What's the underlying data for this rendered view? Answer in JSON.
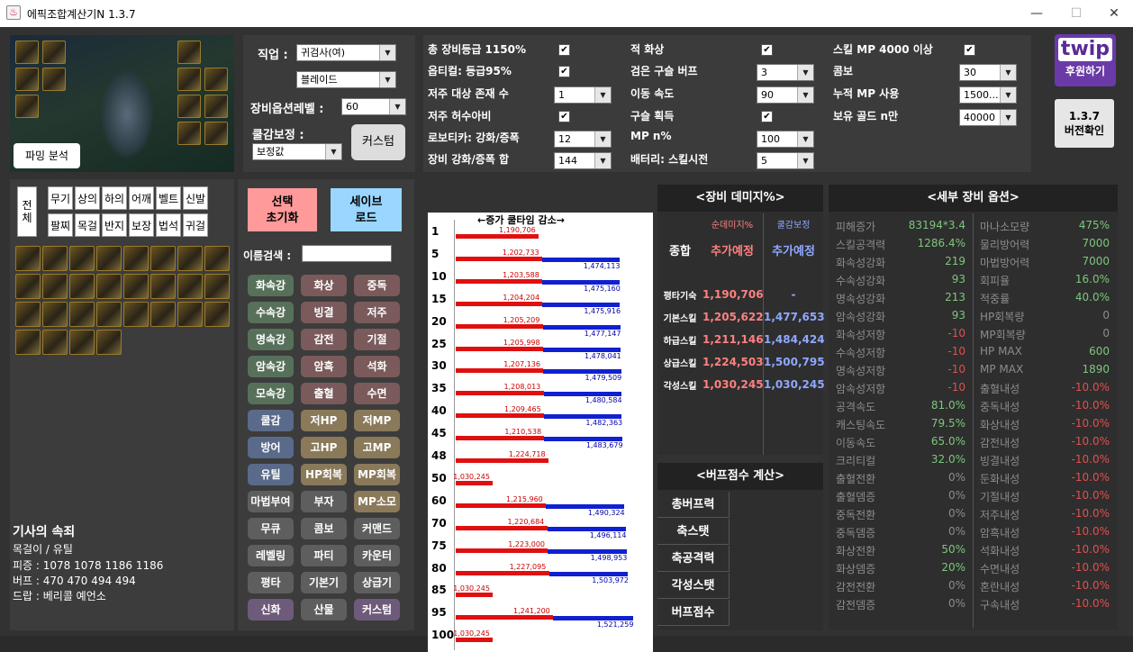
{
  "window": {
    "title": "에픽조합계산기N 1.3.7",
    "minimize": "—",
    "maximize": "☐",
    "close": "✕"
  },
  "left": {
    "parsing_button": "파밍 분석"
  },
  "job": {
    "label": "직업 :",
    "value1": "귀검사(여)",
    "value2": "블레이드",
    "equip_level_label": "장비옵션레벨 :",
    "equip_level": "60",
    "coolreduce_label": "쿨감보정 :",
    "coolreduce_value": "보정값",
    "custom_button": "커스텀"
  },
  "options": [
    {
      "label": "총 장비등급 1150%",
      "type": "check",
      "checked": true
    },
    {
      "label": "옵티컬: 등급95%",
      "type": "check",
      "checked": true
    },
    {
      "label": "저주 대상 존재 수",
      "type": "select",
      "value": "1"
    },
    {
      "label": "저주 허수아비",
      "type": "check",
      "checked": true
    },
    {
      "label": "로보티카: 강화/증폭",
      "type": "select",
      "value": "12"
    },
    {
      "label": "장비 강화/증폭 합",
      "type": "select",
      "value": "144"
    },
    {
      "label": "적 화상",
      "type": "check",
      "checked": true
    },
    {
      "label": "검은 구슬 버프",
      "type": "select",
      "value": "3"
    },
    {
      "label": "이동 속도",
      "type": "select",
      "value": "90"
    },
    {
      "label": "구슬 획득",
      "type": "check",
      "checked": true
    },
    {
      "label": "MP n%",
      "type": "select",
      "value": "100"
    },
    {
      "label": "배터리: 스킬시전",
      "type": "select",
      "value": "5"
    },
    {
      "label": "스킬 MP 4000 이상",
      "type": "check",
      "checked": true
    },
    {
      "label": "콤보",
      "type": "select",
      "value": "30"
    },
    {
      "label": "누적 MP 사용",
      "type": "select",
      "value": "1500..."
    },
    {
      "label": "보유 골드 n만",
      "type": "select",
      "value": "40000"
    }
  ],
  "twip": {
    "logo": "twip",
    "text": "후원하기"
  },
  "version_button": {
    "line1": "1.3.7",
    "line2": "버전확인"
  },
  "slot_tabs": [
    "무기",
    "상의",
    "하의",
    "어깨",
    "벨트",
    "신발",
    "팔찌",
    "목걸",
    "반지",
    "보장",
    "법석",
    "귀걸"
  ],
  "all_tab": "전체",
  "reset_button": {
    "line1": "선택",
    "line2": "초기화"
  },
  "save_button": {
    "line1": "세이브",
    "line2": "로드"
  },
  "name_search": {
    "label": "이름검색 :",
    "value": ""
  },
  "filters": [
    {
      "t": "화속강",
      "c": "fg"
    },
    {
      "t": "화상",
      "c": "fr"
    },
    {
      "t": "중독",
      "c": "fr"
    },
    {
      "t": "수속강",
      "c": "fg"
    },
    {
      "t": "빙결",
      "c": "fr"
    },
    {
      "t": "저주",
      "c": "fr"
    },
    {
      "t": "명속강",
      "c": "fg"
    },
    {
      "t": "감전",
      "c": "fr"
    },
    {
      "t": "기절",
      "c": "fr"
    },
    {
      "t": "암속강",
      "c": "fg"
    },
    {
      "t": "암흑",
      "c": "fr"
    },
    {
      "t": "석화",
      "c": "fr"
    },
    {
      "t": "모속강",
      "c": "fg"
    },
    {
      "t": "출혈",
      "c": "fr"
    },
    {
      "t": "수면",
      "c": "fr"
    },
    {
      "t": "쿨감",
      "c": "fb"
    },
    {
      "t": "저HP",
      "c": "fo"
    },
    {
      "t": "저MP",
      "c": "fo"
    },
    {
      "t": "방어",
      "c": "fb"
    },
    {
      "t": "고HP",
      "c": "fo"
    },
    {
      "t": "고MP",
      "c": "fo"
    },
    {
      "t": "유틸",
      "c": "fb"
    },
    {
      "t": "HP회복",
      "c": "fo"
    },
    {
      "t": "MP회복",
      "c": "fo"
    },
    {
      "t": "마법부여",
      "c": "fgr"
    },
    {
      "t": "부자",
      "c": "fgr"
    },
    {
      "t": "MP소모",
      "c": "fo"
    },
    {
      "t": "무큐",
      "c": "fgr"
    },
    {
      "t": "콤보",
      "c": "fgr"
    },
    {
      "t": "커맨드",
      "c": "fgr"
    },
    {
      "t": "레벨링",
      "c": "fgr"
    },
    {
      "t": "파티",
      "c": "fgr"
    },
    {
      "t": "카운터",
      "c": "fgr"
    },
    {
      "t": "평타",
      "c": "fgr"
    },
    {
      "t": "기본기",
      "c": "fgr"
    },
    {
      "t": "상급기",
      "c": "fgr"
    },
    {
      "t": "신화",
      "c": "fp"
    },
    {
      "t": "산물",
      "c": "fgr"
    },
    {
      "t": "커스텀",
      "c": "fp"
    }
  ],
  "item_info": {
    "name": "기사의 속죄",
    "line1": "목걸이 / 유틸",
    "line2": "피증 : 1078 1078 1186 1186",
    "line3": "버프 : 470 470 494 494",
    "line4": "드랍 : 베리콜 예언소"
  },
  "chart_data": {
    "type": "bar",
    "title": "←증가 쿨타임 감소→",
    "categories": [
      "1",
      "5",
      "10",
      "15",
      "20",
      "25",
      "30",
      "35",
      "40",
      "45",
      "48",
      "50",
      "60",
      "70",
      "75",
      "80",
      "85",
      "95",
      "100"
    ],
    "series": [
      {
        "values": [
          1190706,
          1202733,
          1203588,
          1204204,
          1205209,
          1205998,
          1207136,
          1208013,
          1209465,
          1210538,
          1224718,
          1030245,
          1215960,
          1220684,
          1223000,
          1227095,
          1030245,
          1241200,
          1030245
        ]
      },
      {
        "values": [
          null,
          1474113,
          1475160,
          1475916,
          1477147,
          1478041,
          1479509,
          1480584,
          1482363,
          1483679,
          null,
          null,
          1490324,
          1496114,
          1498953,
          1503972,
          null,
          1521259,
          null
        ]
      }
    ],
    "red_labels": [
      "1,190,706",
      "1,202,733",
      "1,203,588",
      "1,204,204",
      "1,205,209",
      "1,205,998",
      "1,207,136",
      "1,208,013",
      "1,209,465",
      "1,210,538",
      "1,224,718",
      "1,030,245",
      "1,215,960",
      "1,220,684",
      "1,223,000",
      "1,227,095",
      "1,030,245",
      "1,241,200",
      "1,030,245"
    ],
    "blue_labels": [
      "",
      "1,474,113",
      "1,475,160",
      "1,475,916",
      "1,477,147",
      "1,478,041",
      "1,479,509",
      "1,480,584",
      "1,482,363",
      "1,483,679",
      "",
      "",
      "1,490,324",
      "1,496,114",
      "1,498,953",
      "1,503,972",
      "",
      "1,521,259",
      ""
    ]
  },
  "damage": {
    "header": "<장비 데미지%>",
    "col1": "순데미지%",
    "col2": "쿨감보정",
    "row_header": "종합",
    "combined1": "추가예정",
    "combined2": "추가예정",
    "rows": [
      {
        "name": "평타기숙",
        "v1": "1,190,706",
        "v2": "-"
      },
      {
        "name": "기본스킬",
        "v1": "1,205,622",
        "v2": "1,477,653"
      },
      {
        "name": "하급스킬",
        "v1": "1,211,146",
        "v2": "1,484,424"
      },
      {
        "name": "상급스킬",
        "v1": "1,224,503",
        "v2": "1,500,795"
      },
      {
        "name": "각성스킬",
        "v1": "1,030,245",
        "v2": "1,030,245"
      }
    ]
  },
  "buff": {
    "header": "<버프점수 계산>",
    "rows": [
      "총버프력",
      "축스탯",
      "축공격력",
      "각성스탯",
      "버프점수"
    ]
  },
  "detail": {
    "header": "<세부 장비 옵션>",
    "left": [
      [
        "피해증가",
        "83194*3.4",
        "g"
      ],
      [
        "스킬공격력",
        "1286.4%",
        "g"
      ],
      [
        "화속성강화",
        "219",
        "g"
      ],
      [
        "수속성강화",
        "93",
        "g"
      ],
      [
        "명속성강화",
        "213",
        "g"
      ],
      [
        "암속성강화",
        "93",
        "g"
      ],
      [
        "화속성저항",
        "-10",
        "r"
      ],
      [
        "수속성저항",
        "-10",
        "r"
      ],
      [
        "명속성저항",
        "-10",
        "r"
      ],
      [
        "암속성저항",
        "-10",
        "r"
      ],
      [
        "공격속도",
        "81.0%",
        "g"
      ],
      [
        "캐스팅속도",
        "79.5%",
        "g"
      ],
      [
        "이동속도",
        "65.0%",
        "g"
      ],
      [
        "크리티컬",
        "32.0%",
        "g"
      ],
      [
        "출혈전환",
        "0%",
        "n"
      ],
      [
        "출혈뎀증",
        "0%",
        "n"
      ],
      [
        "중독전환",
        "0%",
        "n"
      ],
      [
        "중독뎀증",
        "0%",
        "n"
      ],
      [
        "화상전환",
        "50%",
        "g"
      ],
      [
        "화상뎀증",
        "20%",
        "g"
      ],
      [
        "감전전환",
        "0%",
        "n"
      ],
      [
        "감전뎀증",
        "0%",
        "n"
      ]
    ],
    "right": [
      [
        "마나소모량",
        "475%",
        "g"
      ],
      [
        "물리방어력",
        "7000",
        "g"
      ],
      [
        "마법방어력",
        "7000",
        "g"
      ],
      [
        "회피율",
        "16.0%",
        "g"
      ],
      [
        "적중률",
        "40.0%",
        "g"
      ],
      [
        "HP회복량",
        "0",
        "n"
      ],
      [
        "MP회복량",
        "0",
        "n"
      ],
      [
        "HP MAX",
        "600",
        "g"
      ],
      [
        "MP MAX",
        "1890",
        "g"
      ],
      [
        "출혈내성",
        "-10.0%",
        "r"
      ],
      [
        "중독내성",
        "-10.0%",
        "r"
      ],
      [
        "화상내성",
        "-10.0%",
        "r"
      ],
      [
        "감전내성",
        "-10.0%",
        "r"
      ],
      [
        "빙결내성",
        "-10.0%",
        "r"
      ],
      [
        "둔화내성",
        "-10.0%",
        "r"
      ],
      [
        "기절내성",
        "-10.0%",
        "r"
      ],
      [
        "저주내성",
        "-10.0%",
        "r"
      ],
      [
        "암흑내성",
        "-10.0%",
        "r"
      ],
      [
        "석화내성",
        "-10.0%",
        "r"
      ],
      [
        "수면내성",
        "-10.0%",
        "r"
      ],
      [
        "혼란내성",
        "-10.0%",
        "r"
      ],
      [
        "구속내성",
        "-10.0%",
        "r"
      ]
    ]
  },
  "colors": {
    "red": "#e01010",
    "blue": "#1020d0",
    "green": "#7cc77c",
    "neg": "#e05050",
    "dmg_red": "#ff8080",
    "dmg_blue": "#8fa8ff"
  }
}
